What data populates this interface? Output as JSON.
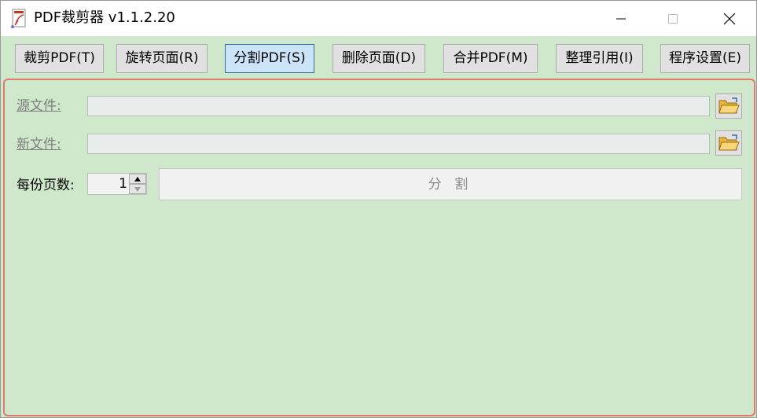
{
  "window": {
    "title": "PDF裁剪器 v1.1.2.20"
  },
  "toolbar": {
    "buttons": [
      {
        "label": "裁剪PDF(T)"
      },
      {
        "label": "旋转页面(R)"
      },
      {
        "label": "分割PDF(S)",
        "active": true
      },
      {
        "label": "删除页面(D)"
      },
      {
        "label": "合并PDF(M)"
      },
      {
        "label": "整理引用(I)"
      },
      {
        "label": "程序设置(E)"
      }
    ]
  },
  "form": {
    "source_label": "源文件",
    "source_value": "",
    "target_label": "新文件",
    "target_value": "",
    "colon": ":",
    "pages_label": "每份页数:",
    "pages_value": "1",
    "split_label": "分 割"
  },
  "icons": {
    "app": "pdf-app-icon",
    "minimize": "minimize-icon",
    "maximize": "maximize-icon",
    "close": "close-icon",
    "folder": "open-folder-icon",
    "up": "spin-up-icon",
    "down": "spin-down-icon"
  },
  "colors": {
    "background": "#cfe8cb",
    "panel_border": "#e07a6e",
    "active_button": "#cce4f7",
    "active_border": "#2b6ca3",
    "button": "#e1e1e1"
  }
}
